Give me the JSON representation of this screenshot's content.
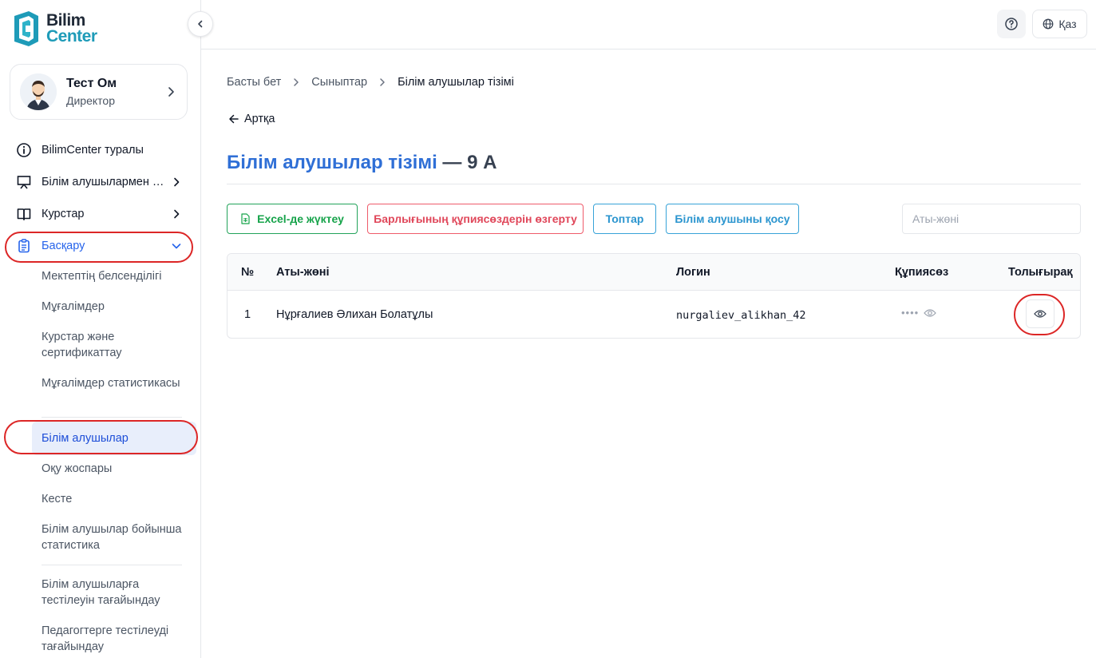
{
  "logo": {
    "line1": "Bilim",
    "line2": "Center"
  },
  "profile": {
    "name": "Тест Ом",
    "role": "Директор"
  },
  "nav": {
    "about": "BilimCenter туралы",
    "students_menu": "Білім алушылармен жұмыс",
    "courses": "Курстар",
    "manage": "Басқару"
  },
  "submenu": [
    {
      "label": "Мектептің белсенділігі"
    },
    {
      "label": "Мұғалімдер"
    },
    {
      "label": "Курстар және сертификаттау"
    },
    {
      "label": "Мұғалімдер статистикасы"
    },
    {
      "label": "Білім алушылар"
    },
    {
      "label": "Оқу жоспары"
    },
    {
      "label": "Кесте"
    },
    {
      "label": "Білім алушылар бойынша статистика"
    },
    {
      "label": "Білім алушыларға тестілеуін тағайындау"
    },
    {
      "label": "Педагогтерге тестілеуді тағайындау"
    }
  ],
  "topbar": {
    "language": "Қаз"
  },
  "breadcrumb": {
    "home": "Басты бет",
    "classes": "Сыныптар",
    "current": "Білім алушылар тізімі"
  },
  "back": "Артқа",
  "title": {
    "main": "Білім алушылар тізімі",
    "suffix": "— 9 А"
  },
  "actions": {
    "excel": "Excel-де жүктеу",
    "change_passwords": "Барлығының құпиясөздерін өзгерту",
    "groups": "Топтар",
    "add_student": "Білім алушыны қосу"
  },
  "search": {
    "placeholder": "Аты-жөні",
    "value": ""
  },
  "table": {
    "headers": {
      "num": "№",
      "name": "Аты-жөні",
      "login": "Логин",
      "password": "Құпиясөз",
      "details": "Толығырақ"
    },
    "rows": [
      {
        "num": "1",
        "name": "Нұрғалиев Әлихан Болатұлы",
        "login": "nurgaliev_alikhan_42",
        "password_mask": "••••"
      }
    ]
  },
  "colors": {
    "accent": "#2563eb",
    "title": "#2f6fd6",
    "green": "#16a34a",
    "red": "#e0475a",
    "blue": "#2b95cf",
    "highlight": "#dc2626"
  }
}
